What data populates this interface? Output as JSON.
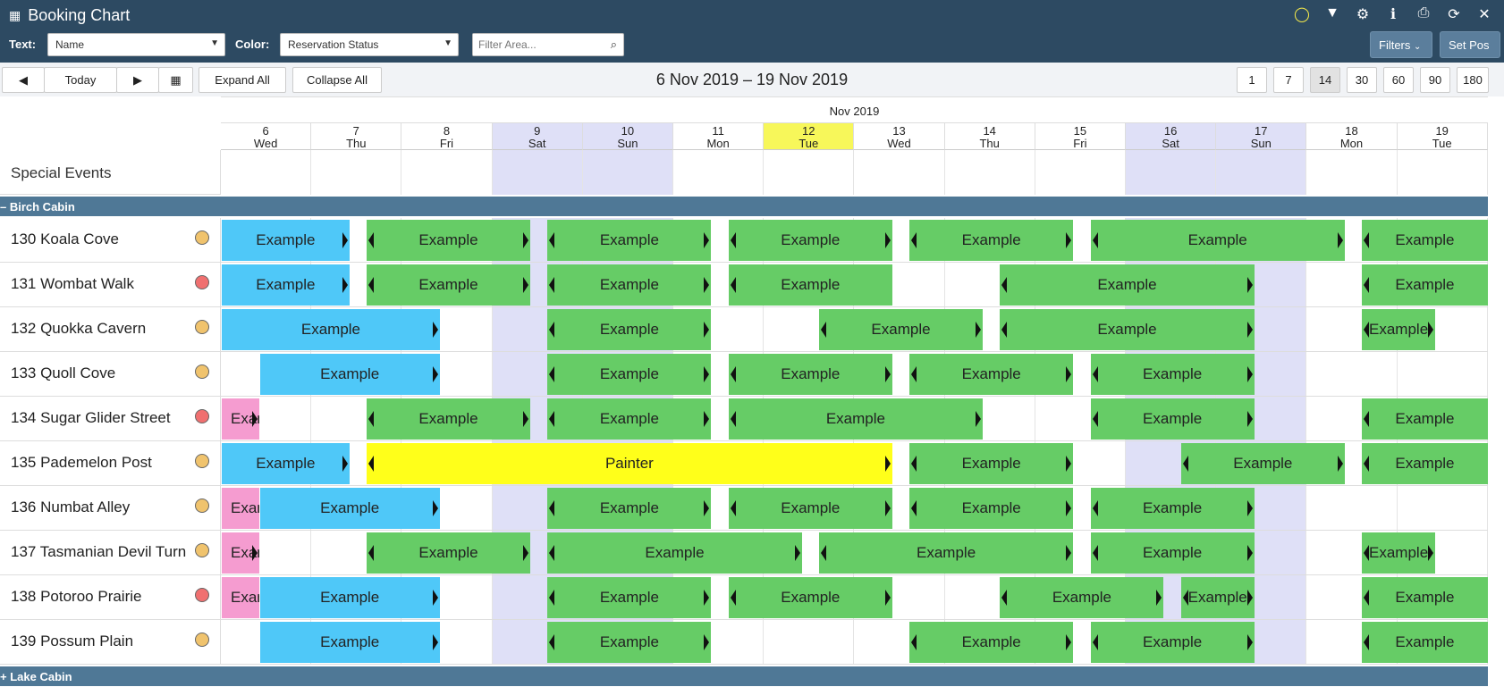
{
  "header": {
    "title": "Booking Chart",
    "text_label": "Text:",
    "text_value": "Name",
    "color_label": "Color:",
    "color_value": "Reservation Status",
    "filter_placeholder": "Filter Area...",
    "filters_button": "Filters",
    "set_pos_button": "Set Pos",
    "icons": [
      "chat-icon",
      "filter-icon",
      "settings-icon",
      "info-icon",
      "print-icon",
      "refresh-icon",
      "close-icon"
    ]
  },
  "toolbar": {
    "prev": "◀",
    "today": "Today",
    "next": "▶",
    "expand_all": "Expand All",
    "collapse_all": "Collapse All",
    "date_range": "6 Nov 2019 – 19 Nov 2019",
    "zoom_options": [
      "1",
      "7",
      "14",
      "30",
      "60",
      "90",
      "180"
    ],
    "zoom_active": "14"
  },
  "calendar": {
    "month": "Nov 2019",
    "days": [
      {
        "num": "6",
        "dow": "Wed"
      },
      {
        "num": "7",
        "dow": "Thu"
      },
      {
        "num": "8",
        "dow": "Fri"
      },
      {
        "num": "9",
        "dow": "Sat"
      },
      {
        "num": "10",
        "dow": "Sun"
      },
      {
        "num": "11",
        "dow": "Mon"
      },
      {
        "num": "12",
        "dow": "Tue"
      },
      {
        "num": "13",
        "dow": "Wed"
      },
      {
        "num": "14",
        "dow": "Thu"
      },
      {
        "num": "15",
        "dow": "Fri"
      },
      {
        "num": "16",
        "dow": "Sat"
      },
      {
        "num": "17",
        "dow": "Sun"
      },
      {
        "num": "18",
        "dow": "Mon"
      },
      {
        "num": "19",
        "dow": "Tue"
      }
    ],
    "special_events_label": "Special Events"
  },
  "groups": [
    {
      "label": "– Birch Cabin"
    },
    {
      "label": "+ Lake Cabin"
    }
  ],
  "rooms": [
    {
      "name": "130 Koala Cove",
      "status": "amber"
    },
    {
      "name": "131 Wombat Walk",
      "status": "red"
    },
    {
      "name": "132 Quokka Cavern",
      "status": "amber"
    },
    {
      "name": "133 Quoll Cove",
      "status": "amber"
    },
    {
      "name": "134 Sugar Glider Street",
      "status": "red"
    },
    {
      "name": "135 Pademelon Post",
      "status": "amber"
    },
    {
      "name": "136 Numbat Alley",
      "status": "amber"
    },
    {
      "name": "137 Tasmanian Devil Turn",
      "status": "amber"
    },
    {
      "name": "138 Potoroo Prairie",
      "status": "red"
    },
    {
      "name": "139 Possum Plain",
      "status": "amber"
    }
  ],
  "bookings": [
    {
      "row": 0,
      "start": 0,
      "end": 1.42,
      "color": "blue",
      "text": "Example",
      "l": false,
      "r": true
    },
    {
      "row": 0,
      "start": 1.6,
      "end": 3.42,
      "color": "green",
      "text": "Example",
      "l": true,
      "r": true
    },
    {
      "row": 0,
      "start": 3.6,
      "end": 5.42,
      "color": "green",
      "text": "Example",
      "l": true,
      "r": true
    },
    {
      "row": 0,
      "start": 5.6,
      "end": 7.42,
      "color": "green",
      "text": "Example",
      "l": true,
      "r": true
    },
    {
      "row": 0,
      "start": 7.6,
      "end": 9.42,
      "color": "green",
      "text": "Example",
      "l": true,
      "r": true
    },
    {
      "row": 0,
      "start": 9.6,
      "end": 12.42,
      "color": "green",
      "text": "Example",
      "l": true,
      "r": true
    },
    {
      "row": 0,
      "start": 12.6,
      "end": 14,
      "color": "green",
      "text": "Example",
      "l": true,
      "r": false
    },
    {
      "row": 1,
      "start": 0,
      "end": 1.42,
      "color": "blue",
      "text": "Example",
      "l": false,
      "r": true
    },
    {
      "row": 1,
      "start": 1.6,
      "end": 3.42,
      "color": "green",
      "text": "Example",
      "l": true,
      "r": true
    },
    {
      "row": 1,
      "start": 3.6,
      "end": 5.42,
      "color": "green",
      "text": "Example",
      "l": true,
      "r": true
    },
    {
      "row": 1,
      "start": 5.6,
      "end": 7.42,
      "color": "green",
      "text": "Example",
      "l": true,
      "r": false
    },
    {
      "row": 1,
      "start": 8.6,
      "end": 11.42,
      "color": "green",
      "text": "Example",
      "l": true,
      "r": true
    },
    {
      "row": 1,
      "start": 12.6,
      "end": 14,
      "color": "green",
      "text": "Example",
      "l": true,
      "r": false
    },
    {
      "row": 2,
      "start": 0,
      "end": 2.42,
      "color": "blue",
      "text": "Example",
      "l": false,
      "r": true
    },
    {
      "row": 2,
      "start": 3.6,
      "end": 5.42,
      "color": "green",
      "text": "Example",
      "l": true,
      "r": true
    },
    {
      "row": 2,
      "start": 6.6,
      "end": 8.42,
      "color": "green",
      "text": "Example",
      "l": true,
      "r": true
    },
    {
      "row": 2,
      "start": 8.6,
      "end": 11.42,
      "color": "green",
      "text": "Example",
      "l": true,
      "r": true
    },
    {
      "row": 2,
      "start": 12.6,
      "end": 13.42,
      "color": "green",
      "text": "Example",
      "l": true,
      "r": true
    },
    {
      "row": 3,
      "start": 0.42,
      "end": 2.42,
      "color": "blue",
      "text": "Example",
      "l": false,
      "r": true
    },
    {
      "row": 3,
      "start": 3.6,
      "end": 5.42,
      "color": "green",
      "text": "Example",
      "l": true,
      "r": true
    },
    {
      "row": 3,
      "start": 5.6,
      "end": 7.42,
      "color": "green",
      "text": "Example",
      "l": true,
      "r": true
    },
    {
      "row": 3,
      "start": 7.6,
      "end": 9.42,
      "color": "green",
      "text": "Example",
      "l": true,
      "r": true
    },
    {
      "row": 3,
      "start": 9.6,
      "end": 11.42,
      "color": "green",
      "text": "Example",
      "l": true,
      "r": true
    },
    {
      "row": 4,
      "start": 0,
      "end": 0.42,
      "color": "pink",
      "text": "Example",
      "l": false,
      "r": true
    },
    {
      "row": 4,
      "start": 1.6,
      "end": 3.42,
      "color": "green",
      "text": "Example",
      "l": true,
      "r": true
    },
    {
      "row": 4,
      "start": 3.6,
      "end": 5.42,
      "color": "green",
      "text": "Example",
      "l": true,
      "r": true
    },
    {
      "row": 4,
      "start": 5.6,
      "end": 8.42,
      "color": "green",
      "text": "Example",
      "l": true,
      "r": true
    },
    {
      "row": 4,
      "start": 9.6,
      "end": 11.42,
      "color": "green",
      "text": "Example",
      "l": true,
      "r": true
    },
    {
      "row": 4,
      "start": 12.6,
      "end": 14,
      "color": "green",
      "text": "Example",
      "l": true,
      "r": false
    },
    {
      "row": 5,
      "start": 0,
      "end": 1.42,
      "color": "blue",
      "text": "Example",
      "l": false,
      "r": true
    },
    {
      "row": 5,
      "start": 1.6,
      "end": 7.42,
      "color": "yellow",
      "text": "Painter",
      "l": true,
      "r": true
    },
    {
      "row": 5,
      "start": 7.6,
      "end": 9.42,
      "color": "green",
      "text": "Example",
      "l": true,
      "r": true
    },
    {
      "row": 5,
      "start": 10.6,
      "end": 12.42,
      "color": "green",
      "text": "Example",
      "l": true,
      "r": true
    },
    {
      "row": 5,
      "start": 12.6,
      "end": 14,
      "color": "green",
      "text": "Example",
      "l": true,
      "r": false
    },
    {
      "row": 6,
      "start": 0,
      "end": 0.42,
      "color": "pink",
      "text": "Example",
      "l": false,
      "r": false
    },
    {
      "row": 6,
      "start": 0.42,
      "end": 2.42,
      "color": "blue",
      "text": "Example",
      "l": false,
      "r": true
    },
    {
      "row": 6,
      "start": 3.6,
      "end": 5.42,
      "color": "green",
      "text": "Example",
      "l": true,
      "r": true
    },
    {
      "row": 6,
      "start": 5.6,
      "end": 7.42,
      "color": "green",
      "text": "Example",
      "l": true,
      "r": true
    },
    {
      "row": 6,
      "start": 7.6,
      "end": 9.42,
      "color": "green",
      "text": "Example",
      "l": true,
      "r": true
    },
    {
      "row": 6,
      "start": 9.6,
      "end": 11.42,
      "color": "green",
      "text": "Example",
      "l": true,
      "r": true
    },
    {
      "row": 7,
      "start": 0,
      "end": 0.42,
      "color": "pink",
      "text": "Example",
      "l": false,
      "r": true
    },
    {
      "row": 7,
      "start": 1.6,
      "end": 3.42,
      "color": "green",
      "text": "Example",
      "l": true,
      "r": true
    },
    {
      "row": 7,
      "start": 3.6,
      "end": 6.42,
      "color": "green",
      "text": "Example",
      "l": true,
      "r": true
    },
    {
      "row": 7,
      "start": 6.6,
      "end": 9.42,
      "color": "green",
      "text": "Example",
      "l": true,
      "r": true
    },
    {
      "row": 7,
      "start": 9.6,
      "end": 11.42,
      "color": "green",
      "text": "Example",
      "l": true,
      "r": true
    },
    {
      "row": 7,
      "start": 12.6,
      "end": 13.42,
      "color": "green",
      "text": "Example",
      "l": true,
      "r": true
    },
    {
      "row": 8,
      "start": 0,
      "end": 0.42,
      "color": "pink",
      "text": "Example",
      "l": false,
      "r": false
    },
    {
      "row": 8,
      "start": 0.42,
      "end": 2.42,
      "color": "blue",
      "text": "Example",
      "l": false,
      "r": true
    },
    {
      "row": 8,
      "start": 3.6,
      "end": 5.42,
      "color": "green",
      "text": "Example",
      "l": true,
      "r": true
    },
    {
      "row": 8,
      "start": 5.6,
      "end": 7.42,
      "color": "green",
      "text": "Example",
      "l": true,
      "r": true
    },
    {
      "row": 8,
      "start": 8.6,
      "end": 10.42,
      "color": "green",
      "text": "Example",
      "l": true,
      "r": true
    },
    {
      "row": 8,
      "start": 10.6,
      "end": 11.42,
      "color": "green",
      "text": "Example",
      "l": true,
      "r": true
    },
    {
      "row": 8,
      "start": 12.6,
      "end": 14,
      "color": "green",
      "text": "Example",
      "l": true,
      "r": false
    },
    {
      "row": 9,
      "start": 0.42,
      "end": 2.42,
      "color": "blue",
      "text": "Example",
      "l": false,
      "r": true
    },
    {
      "row": 9,
      "start": 3.6,
      "end": 5.42,
      "color": "green",
      "text": "Example",
      "l": true,
      "r": true
    },
    {
      "row": 9,
      "start": 7.6,
      "end": 9.42,
      "color": "green",
      "text": "Example",
      "l": true,
      "r": true
    },
    {
      "row": 9,
      "start": 9.6,
      "end": 11.42,
      "color": "green",
      "text": "Example",
      "l": true,
      "r": true
    },
    {
      "row": 9,
      "start": 12.6,
      "end": 14,
      "color": "green",
      "text": "Example",
      "l": true,
      "r": false
    }
  ]
}
